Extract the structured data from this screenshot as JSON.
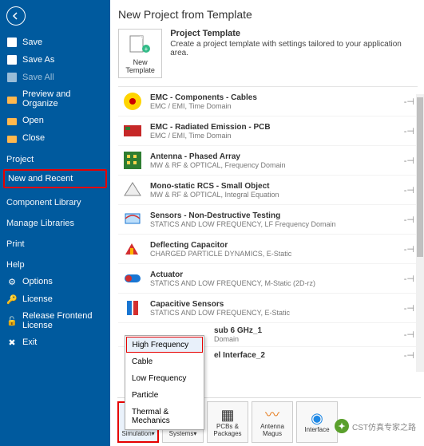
{
  "sidebar": {
    "items": [
      {
        "label": "Save"
      },
      {
        "label": "Save As"
      },
      {
        "label": "Save All"
      },
      {
        "label": "Preview and Organize"
      },
      {
        "label": "Open"
      },
      {
        "label": "Close"
      }
    ],
    "sections": {
      "project": "Project",
      "new_recent": "New and Recent",
      "comp_lib": "Component Library",
      "manage_lib": "Manage Libraries",
      "print": "Print",
      "help": "Help"
    },
    "bottom": [
      {
        "label": "Options"
      },
      {
        "label": "License"
      },
      {
        "label": "Release Frontend License"
      },
      {
        "label": "Exit"
      }
    ]
  },
  "main": {
    "title": "New Project from Template",
    "header": {
      "tile_label": "New Template",
      "pt_title": "Project Template",
      "pt_desc": "Create a project template with settings tailored to your application area."
    },
    "pin": "-⊣",
    "rows": [
      {
        "title": "EMC - Components - Cables",
        "sub": "EMC / EMI, Time Domain"
      },
      {
        "title": "EMC - Radiated Emission - PCB",
        "sub": "EMC / EMI, Time Domain"
      },
      {
        "title": "Antenna - Phased Array",
        "sub": "MW & RF & OPTICAL, Frequency Domain"
      },
      {
        "title": "Mono-static RCS - Small Object",
        "sub": "MW & RF & OPTICAL, Integral Equation"
      },
      {
        "title": "Sensors - Non-Destructive Testing",
        "sub": "STATICS AND LOW FREQUENCY, LF Frequency Domain"
      },
      {
        "title": "Deflecting Capacitor",
        "sub": "CHARGED PARTICLE DYNAMICS, E-Static"
      },
      {
        "title": "Actuator",
        "sub": "STATICS AND LOW FREQUENCY, M-Static (2D-rz)"
      },
      {
        "title": "Capacitive Sensors",
        "sub": "STATICS AND LOW FREQUENCY, E-Static"
      },
      {
        "title": "sub 6 GHz_1",
        "sub": "Domain"
      },
      {
        "title": "el Interface_2",
        "sub": ""
      }
    ]
  },
  "dropdown": {
    "items": [
      "High Frequency",
      "Cable",
      "Low Frequency",
      "Particle",
      "Thermal & Mechanics"
    ]
  },
  "bottombar": {
    "b0": "3D Simulation▾",
    "b1": "Circuits & Systems▾",
    "b2": "PCBs & Packages",
    "b3": "Antenna Magus",
    "b4": "Interface"
  },
  "watermark": "CST仿真专家之路"
}
